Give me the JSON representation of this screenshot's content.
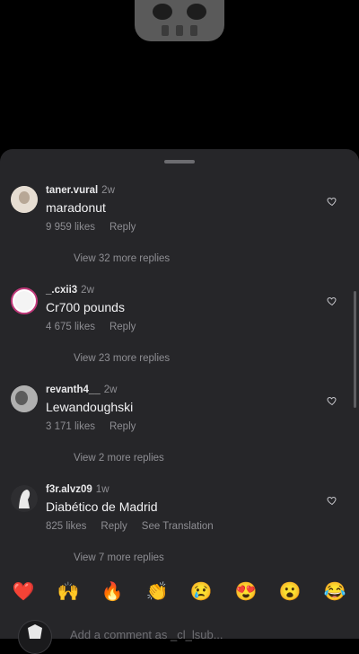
{
  "comments": [
    {
      "username": "taner.vural",
      "time": "2w",
      "text": "maradonut",
      "likes": "9 959 likes",
      "reply": "Reply",
      "see_translation": "",
      "view_replies": "View 32 more replies"
    },
    {
      "username": "_.cxii3",
      "time": "2w",
      "text": "Cr700 pounds",
      "likes": "4 675 likes",
      "reply": "Reply",
      "see_translation": "",
      "view_replies": "View 23 more replies"
    },
    {
      "username": "revanth4__",
      "time": "2w",
      "text": "Lewandoughski",
      "likes": "3 171 likes",
      "reply": "Reply",
      "see_translation": "",
      "view_replies": "View 2 more replies"
    },
    {
      "username": "f3r.alvz09",
      "time": "1w",
      "text": "Diabético de Madrid",
      "likes": "825 likes",
      "reply": "Reply",
      "see_translation": "See Translation",
      "view_replies": "View 7 more replies"
    }
  ],
  "emojis": [
    "❤️",
    "🙌",
    "🔥",
    "👏",
    "😢",
    "😍",
    "😮",
    "😂"
  ],
  "compose": {
    "placeholder": "Add a comment as _cl_lsub..."
  },
  "icons": {
    "like": "heart-outline-icon"
  },
  "colors": {
    "sheet": "#262629",
    "text_secondary": "#8e8e93",
    "background": "#000000"
  }
}
